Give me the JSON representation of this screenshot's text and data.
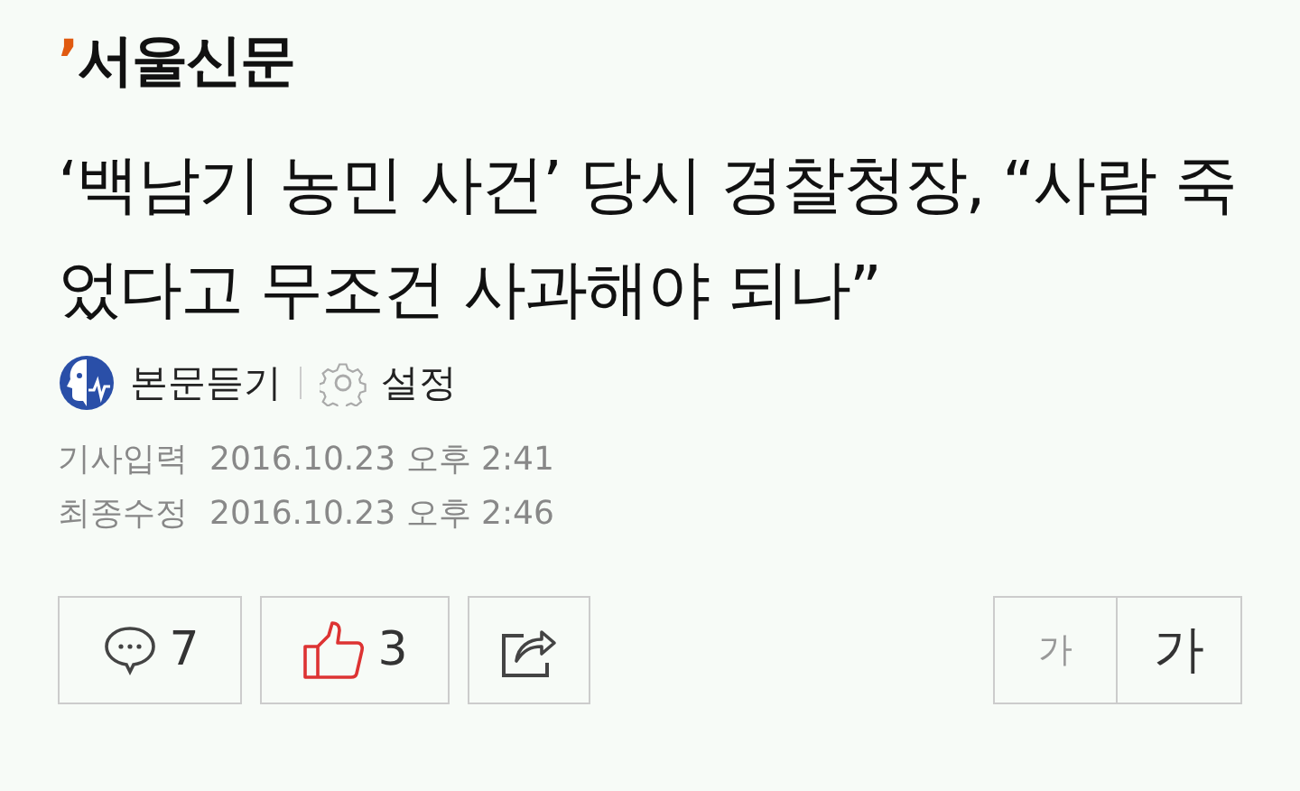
{
  "logo": {
    "mark": "’",
    "name": "서울신문"
  },
  "headline": "‘백남기 농민 사건’ 당시 경찰청장, “사람 죽었다고 무조건 사과해야 되나”",
  "tools": [
    {
      "kind": "listen",
      "label": "본문듣기"
    },
    {
      "kind": "settings",
      "label": "설정"
    }
  ],
  "dates": [
    {
      "label": "기사입력",
      "value": "2016.10.23 오후 2:41"
    },
    {
      "label": "최종수정",
      "value": "2016.10.23 오후 2:46"
    }
  ],
  "actions": [
    {
      "kind": "comment",
      "count": "7"
    },
    {
      "kind": "like",
      "count": "3"
    },
    {
      "kind": "share"
    }
  ],
  "font_size": [
    {
      "label": "가",
      "selected": false
    },
    {
      "label": "가",
      "selected": true
    }
  ]
}
